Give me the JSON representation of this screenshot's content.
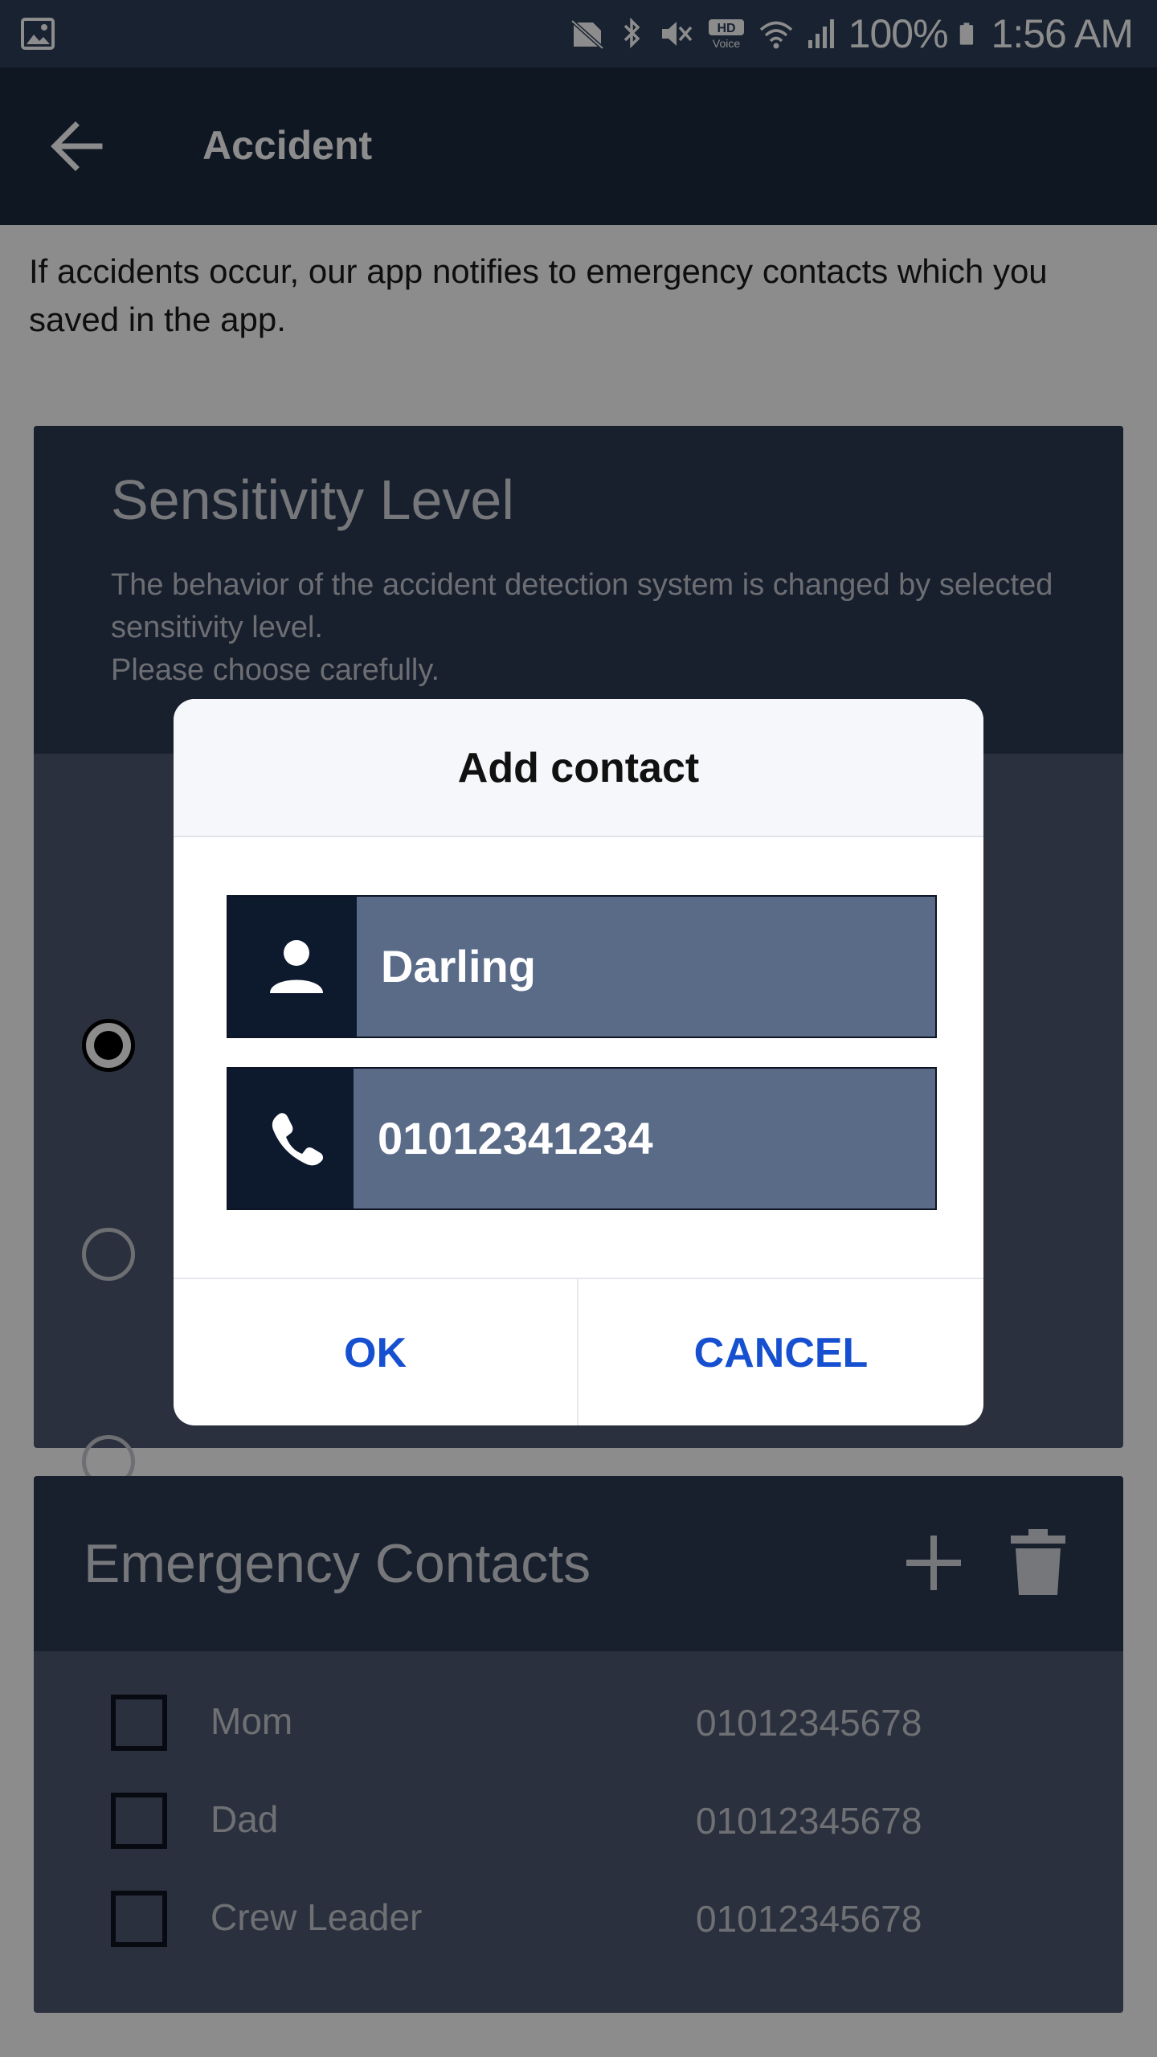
{
  "status_bar": {
    "battery": "100%",
    "time": "1:56 AM",
    "icons": [
      "gallery-icon",
      "no-sim-icon",
      "bluetooth-icon",
      "mute-icon",
      "hd-voice-icon",
      "wifi-icon",
      "signal-icon",
      "battery-icon"
    ]
  },
  "app_bar": {
    "title": "Accident",
    "back_icon": "arrow-left-icon"
  },
  "intro_text": "If accidents occur, our app notifies to emergency contacts which you saved in the app.",
  "sensitivity": {
    "title": "Sensitivity Level",
    "description": "The behavior of the accident detection system is changed by selected sensitivity level.\nPlease choose carefully.",
    "options": [
      {
        "selected": true
      },
      {
        "selected": false
      },
      {
        "selected": false
      }
    ]
  },
  "emergency": {
    "title": "Emergency Contacts",
    "add_icon": "plus-icon",
    "delete_icon": "trash-icon",
    "contacts": [
      {
        "name": "Mom",
        "number": "01012345678"
      },
      {
        "name": "Dad",
        "number": "01012345678"
      },
      {
        "name": "Crew Leader",
        "number": "01012345678"
      }
    ]
  },
  "dialog": {
    "title": "Add contact",
    "name_value": "Darling",
    "name_icon": "person-icon",
    "phone_value": "01012341234",
    "phone_icon": "phone-icon",
    "ok_label": "OK",
    "cancel_label": "CANCEL"
  },
  "colors": {
    "accent": "#1650d0",
    "app_bar": "#1c2a40",
    "status_bar": "#2c3e58"
  }
}
